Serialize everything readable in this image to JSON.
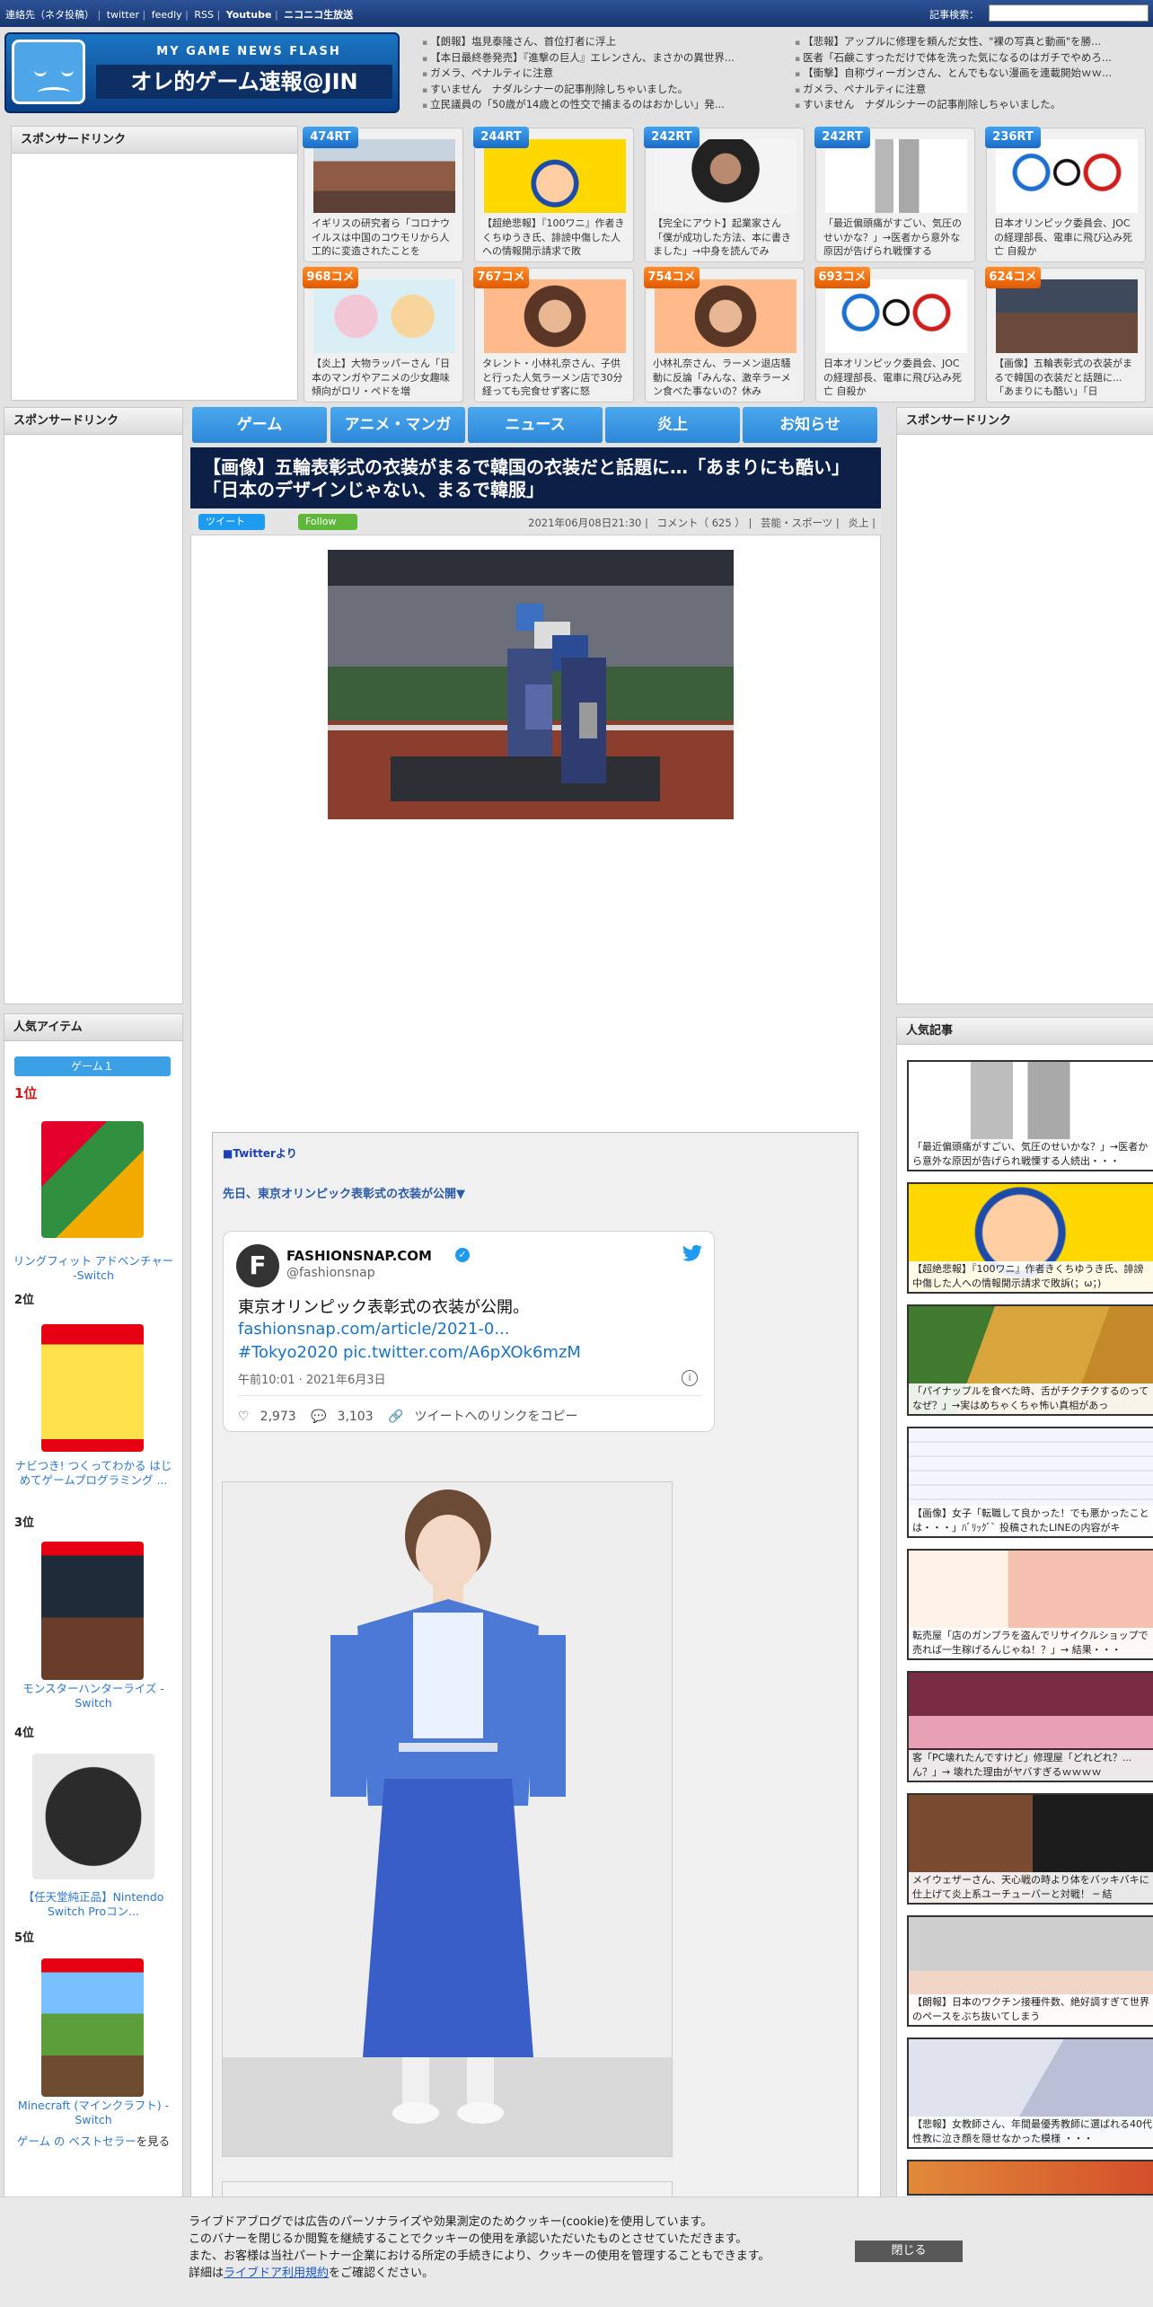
{
  "topbar": {
    "links": [
      "連絡先（ネタ投稿）",
      "twitter",
      "feedly",
      "RSS",
      "Youtube",
      "ニコニコ生放送"
    ],
    "search_label": "記事検索："
  },
  "logo": {
    "subtitle": "MY GAME NEWS FLASH",
    "title": "オレ的ゲーム速報@JIN"
  },
  "headlines": {
    "left": [
      "【朗報】塩見泰隆さん、首位打者に浮上",
      "【本日最終巻発売】『進撃の巨人』エレンさん、まさかの異世界...",
      "ガメラ、ペナルティに注意",
      "すいません　ナダルシナーの記事削除しちゃいました。",
      "立民議員の「50歳が14歳との性交で捕まるのはおかしい」発..."
    ],
    "right": [
      "【悲報】アップルに修理を頼んだ女性、\"裸の写真と動画\"を勝...",
      "医者「石鹸こすっただけで体を洗った気になるのはガチでやめろ...",
      "【衝撃】自称ヴィーガンさん、とんでもない漫画を連載開始ｗｗ...",
      "ガメラ、ペナルティに注意",
      "すいません　ナダルシナーの記事削除しちゃいました。"
    ]
  },
  "sponsor_label": "スポンサードリンク",
  "rt_cards": [
    {
      "badge": "474RT",
      "text": "イギリスの研究者ら「コロナウイルスは中国のコウモリから人工的に変造されたことを"
    },
    {
      "badge": "244RT",
      "text": "【超絶悲報】『100ワニ』作者きくちゆうき氏、誹謗中傷した人への情報開示請求で敗"
    },
    {
      "badge": "242RT",
      "text": "【完全にアウト】起業家さん「僕が成功した方法、本に書きました」→中身を読んでみ"
    },
    {
      "badge": "242RT",
      "text": "「最近偏頭痛がすごい、気圧のせいかな？」→医者から意外な原因が告げられ戦慄する"
    },
    {
      "badge": "236RT",
      "text": "日本オリンピック委員会、JOCの経理部長、電車に飛び込み死亡 自殺か"
    },
    {
      "badge": "968コメ",
      "text": "【炎上】大物ラッパーさん「日本のマンガやアニメの少女趣味傾向がロリ・ペドを増"
    },
    {
      "badge": "767コメ",
      "text": "タレント・小林礼奈さん、子供と行った人気ラーメン店で30分経っても完食せず客に怒"
    },
    {
      "badge": "754コメ",
      "text": "小林礼奈さん、ラーメン退店騒動に反論「みんな、激辛ラーメン食べた事ないの？休み"
    },
    {
      "badge": "693コメ",
      "text": "日本オリンピック委員会、JOCの経理部長、電車に飛び込み死亡 自殺か"
    },
    {
      "badge": "624コメ",
      "text": "【画像】五輪表彰式の衣装がまるで韓国の衣装だと話題に...「あまりにも酷い」「日"
    }
  ],
  "nav": [
    "ゲーム",
    "アニメ・マンガ",
    "ニュース",
    "炎上",
    "お知らせ"
  ],
  "article": {
    "title": "【画像】五輪表彰式の衣装がまるで韓国の衣装だと話題に…「あまりにも酷い」「日本のデザインじゃない、まるで韓服」",
    "tweet_btn": "ツイート",
    "follow_btn": "Follow",
    "datetime": "2021年06月08日21:30",
    "comments": "コメント（ 625 ）",
    "category": "芸能・スポーツ",
    "tag": "炎上"
  },
  "embed": {
    "source": "■Twitterより",
    "lead": "先日、東京オリンピック表彰式の衣装が公開▼",
    "tweet": {
      "avatar": "F",
      "name": "FASHIONSNAP.COM",
      "verified": "✓",
      "handle": "@fashionsnap",
      "text": "東京オリンピック表彰式の衣装が公開。",
      "link1": "fashionsnap.com/article/2021-0...",
      "link2": "#Tokyo2020 pic.twitter.com/A6pXOk6mzM",
      "date": "午前10:01 · 2021年6月3日",
      "info": "i",
      "likes": "2,973",
      "replies": "3,103",
      "copy": "ツイートへのリンクをコピー"
    }
  },
  "items": {
    "title": "人気アイテム",
    "tab": "ゲーム１",
    "ranks": [
      "1位",
      "2位",
      "3位",
      "4位",
      "5位"
    ],
    "products": [
      "リングフィット アドベンチャー -Switch",
      "ナビつき! つくってわかる はじめてゲームプログラミング ...",
      "モンスターハンターライズ -Switch",
      "【任天堂純正品】Nintendo Switch Proコン...",
      "Minecraft (マインクラフト) - Switch"
    ],
    "bestseller_link": "ゲーム の ベストセラー",
    "bestseller_suffix": "を見る"
  },
  "popular": {
    "title": "人気記事",
    "items": [
      "「最近偏頭痛がすごい、気圧のせいかな？」→医者から意外な原因が告げられ戦慄する人続出・・・",
      "【超絶悲報】『100ワニ』作者きくちゆうき氏、誹謗中傷した人への情報開示請求で敗訴(；ω；)",
      "「パイナップルを食べた時、舌がチクチクするのってなぜ？」→実はめちゃくちゃ怖い真相があっ",
      "【画像】女子「転職して良かった！でも悪かったことは・・・」ﾊﾞﾘｯｸﾞﾞ 投稿されたLINEの内容がキ",
      "転売屋「店のガンプラを盗んでリサイクルショップで売れば一生稼げるんじゃね！？」→ 結果・・・",
      "客「PC壊れたんですけど」修理屋「どれどれ？...ん？」→ 壊れた理由がヤバすぎるｗｗｗｗ",
      "メイウェザーさん、天心戦の時より体をバッキバキに仕上げて炎上系ユーチューバーと対戦！ ─ 結",
      "【朗報】日本のワクチン接種件数、絶好調すぎて世界のペースをぶち抜いてしまう",
      "【悲報】女教師さん、年間最優秀教師に選ばれる40代性教に泣き顔を隠せなかった模様 ・・・"
    ]
  },
  "cookie": {
    "line1": "ライブドアブログでは広告のパーソナライズや効果測定のためクッキー(cookie)を使用しています。",
    "line2": "このバナーを閉じるか閲覧を継続することでクッキーの使用を承認いただいたものとさせていただきます。",
    "line3": "また、お客様は当社パートナー企業における所定の手続きにより、クッキーの使用を管理することもできます。",
    "line4_prefix": "詳細は",
    "link": "ライブドア利用規約",
    "line4_suffix": "をご確認ください。",
    "close": "閉じる"
  },
  "colors": {
    "accent": "#2d87d8",
    "topbar": "#1b3d7a",
    "title_bg": "#0c1f46",
    "rank_first": "#d41515"
  }
}
